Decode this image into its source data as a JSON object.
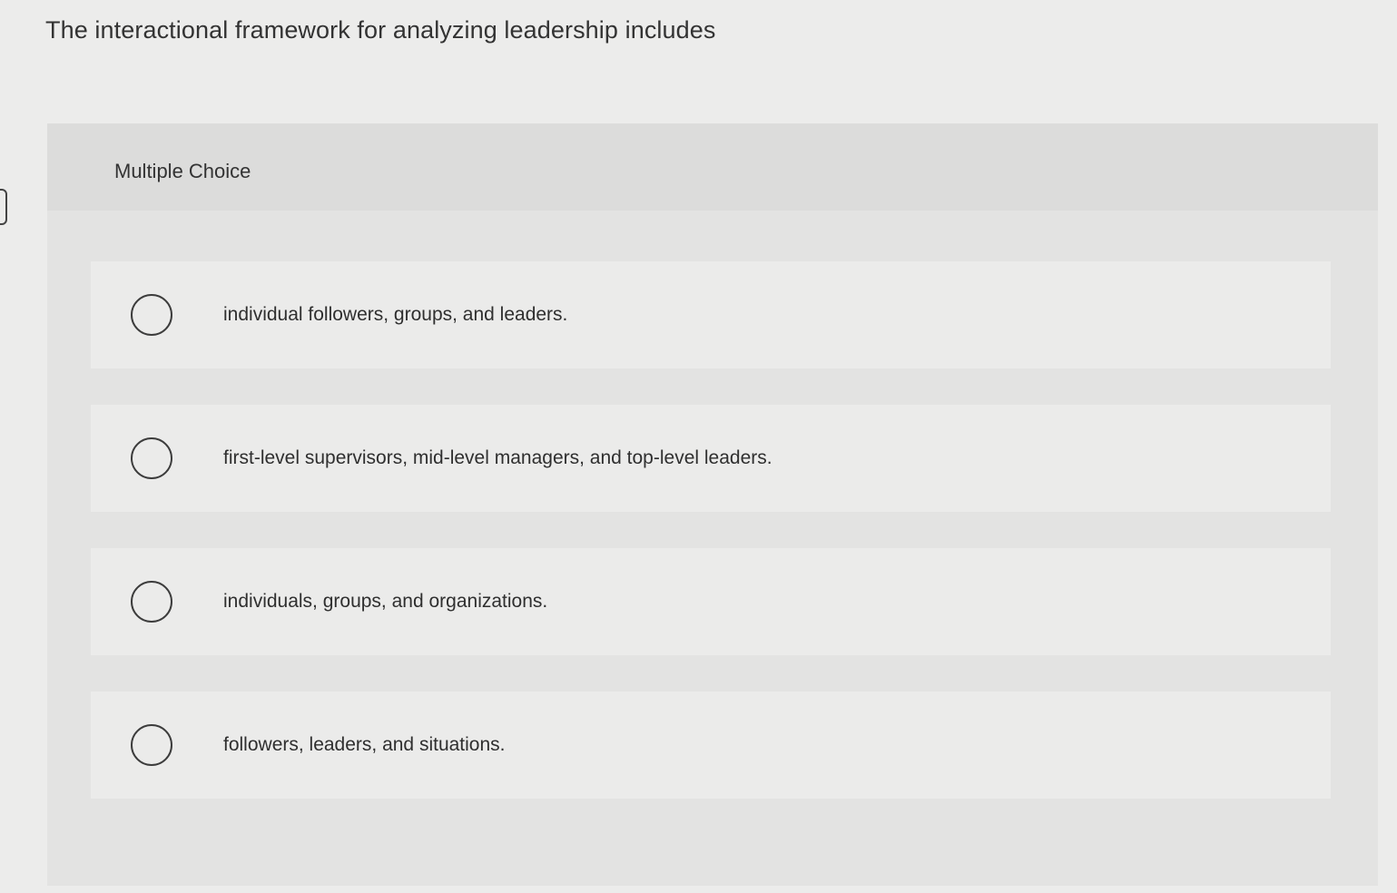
{
  "question": {
    "text": "The interactional framework for analyzing leadership includes"
  },
  "card": {
    "type_label": "Multiple Choice",
    "options": [
      {
        "label": "individual followers, groups, and leaders."
      },
      {
        "label": "first-level supervisors, mid-level managers, and top-level leaders."
      },
      {
        "label": "individuals, groups, and organizations."
      },
      {
        "label": "followers, leaders, and situations."
      }
    ]
  },
  "colors": {
    "page_background": "#ececeb",
    "card_background": "#e3e3e2",
    "option_background": "#ebebea",
    "radio_border": "#3c3c3c"
  },
  "icons": {
    "radio": "radio-unselected-icon"
  }
}
